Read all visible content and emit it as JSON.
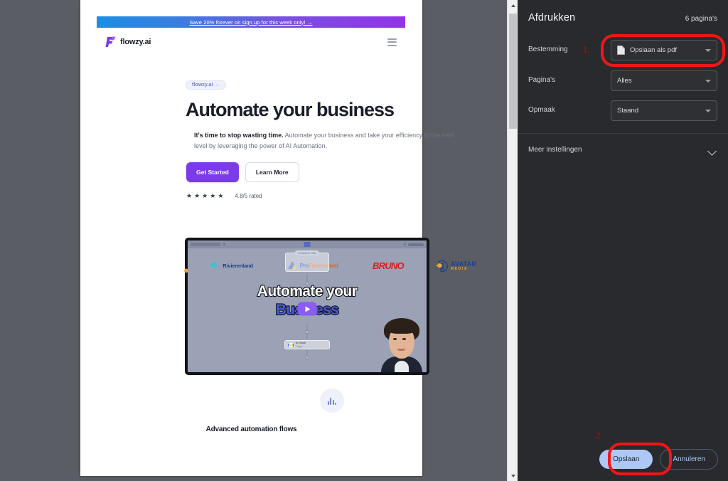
{
  "preview": {
    "promo": {
      "text": "Save 20% forever on sign up for this week only! →"
    },
    "header": {
      "brand": "flowzy.ai",
      "menu_icon": "hamburger-icon"
    },
    "badge": {
      "text": "flowzy.ai →"
    },
    "hero": {
      "title": "Automate your business",
      "subtitle_bold": "It's time to stop wasting time.",
      "subtitle_rest": " Automate your business and take your efficiency to the next level by leveraging the power of AI Automation.",
      "primary_button": "Get Started",
      "secondary_button": "Learn More",
      "stars": "★ ★ ★ ★ ★",
      "rating_text": "4.8/5 rated"
    },
    "video": {
      "headline_line1": "Automate your",
      "headline_line2": "Business",
      "play_icon": "play-icon",
      "logos": [
        {
          "name": "Rivierenland",
          "prefix": "cc"
        },
        {
          "name": "ProFunctioneel",
          "part_blue": "Pro",
          "part_orange": "Functioneel",
          "chip": "Complete Gids"
        },
        {
          "name": "BRUNO"
        },
        {
          "name": "AVATAR",
          "sub": "MEDIA"
        }
      ],
      "gmail_node": {
        "title": "In Gmail",
        "sub": "Trigger"
      }
    },
    "feature": {
      "icon": "bar-chart-icon",
      "title": "Advanced automation flows"
    },
    "scrollbar": {
      "up_icon": "scroll-up-arrow",
      "down_icon": "scroll-down-arrow"
    }
  },
  "dialog": {
    "title": "Afdrukken",
    "page_count": "6 pagina's",
    "fields": [
      {
        "label": "Bestemming",
        "value": "Opslaan als pdf",
        "icon": "pdf-document-icon"
      },
      {
        "label": "Pagina's",
        "value": "Alles",
        "icon": ""
      },
      {
        "label": "Opmaak",
        "value": "Staand",
        "icon": ""
      }
    ],
    "more_settings": {
      "label": "Meer instellingen",
      "icon": "chevron-down-icon"
    },
    "actions": {
      "save": "Opslaan",
      "cancel": "Annuleren"
    }
  },
  "annotations": {
    "marker_1": "1.",
    "marker_2": "2.",
    "highlight_color": "#f01616"
  }
}
